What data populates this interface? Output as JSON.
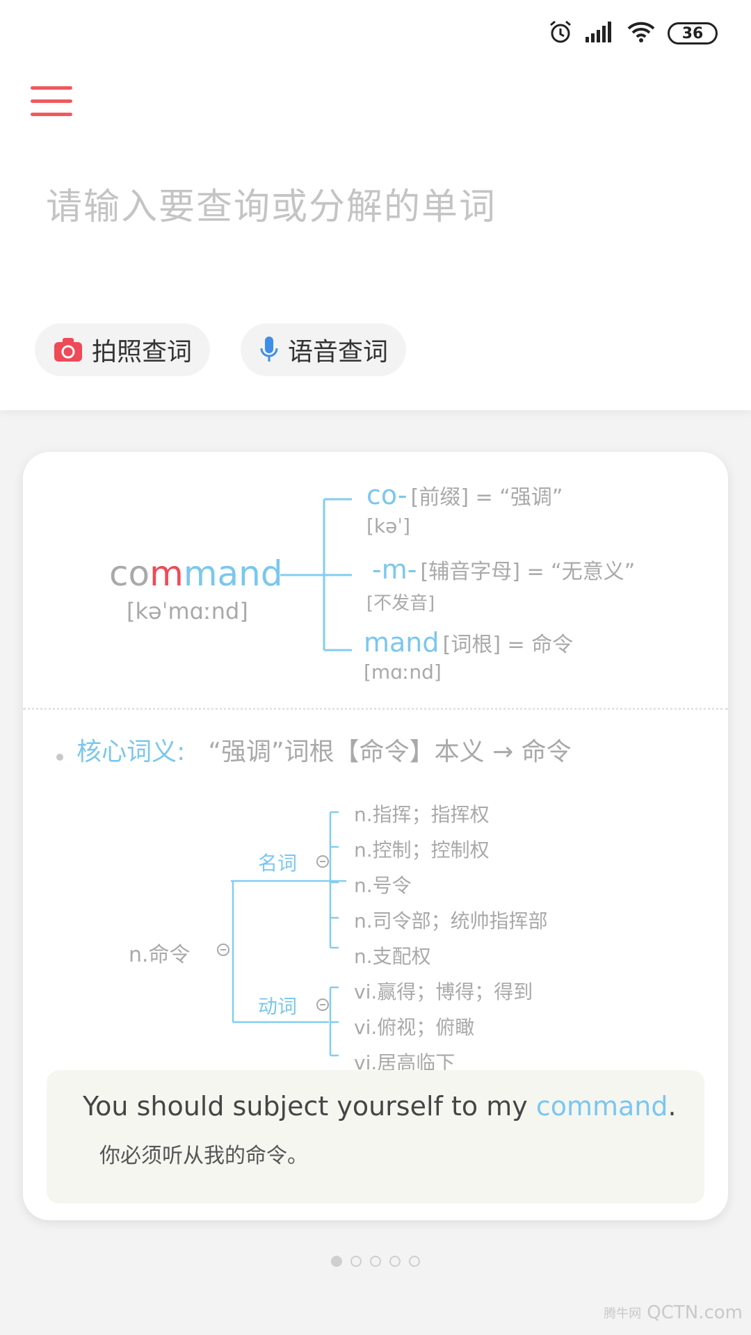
{
  "status": {
    "battery": "36"
  },
  "search": {
    "placeholder": "请输入要查询或分解的单词"
  },
  "buttons": {
    "photo_label": "拍照查词",
    "voice_label": "语音查词"
  },
  "card": {
    "word_parts": [
      "co",
      "m",
      "mand"
    ],
    "word_phonetic": "[kəˈmɑːnd]",
    "morphemes": [
      {
        "part": "co-",
        "desc": "[前缀] = “强调”",
        "sub": "[kəˈ]"
      },
      {
        "part": "-m-",
        "desc": "[辅音字母] = “无意义”",
        "sub": "[不发音]"
      },
      {
        "part": "mand",
        "desc": "[词根] =  命令",
        "sub": "[mɑːnd]"
      }
    ],
    "core_label": "核心词义:",
    "core_text": "“强调”词根【命令】本义 → 命令",
    "root_sense": "n.命令",
    "noun_label": "名词",
    "verb_label": "动词",
    "noun_senses": [
      "n.指挥；指挥权",
      "n.控制；控制权",
      "n.号令",
      "n.司令部；统帅指挥部",
      "n.支配权"
    ],
    "verb_senses": [
      "vi.赢得；博得；得到",
      "vi.俯视；俯瞰",
      "vi.居高临下"
    ],
    "example": {
      "before": "You should subject yourself to my ",
      "highlight": "command",
      "after": ".",
      "translation": "你必须听从我的命令。"
    }
  },
  "pagination": {
    "total": 5,
    "active": 1
  },
  "watermark": {
    "text": "QCTN.com",
    "small": "腾牛网"
  },
  "colors": {
    "accent_red": "#ee4a57",
    "accent_blue": "#7ac7ef",
    "menu_red": "#f05a5f",
    "voice_blue": "#3d8ee6"
  }
}
